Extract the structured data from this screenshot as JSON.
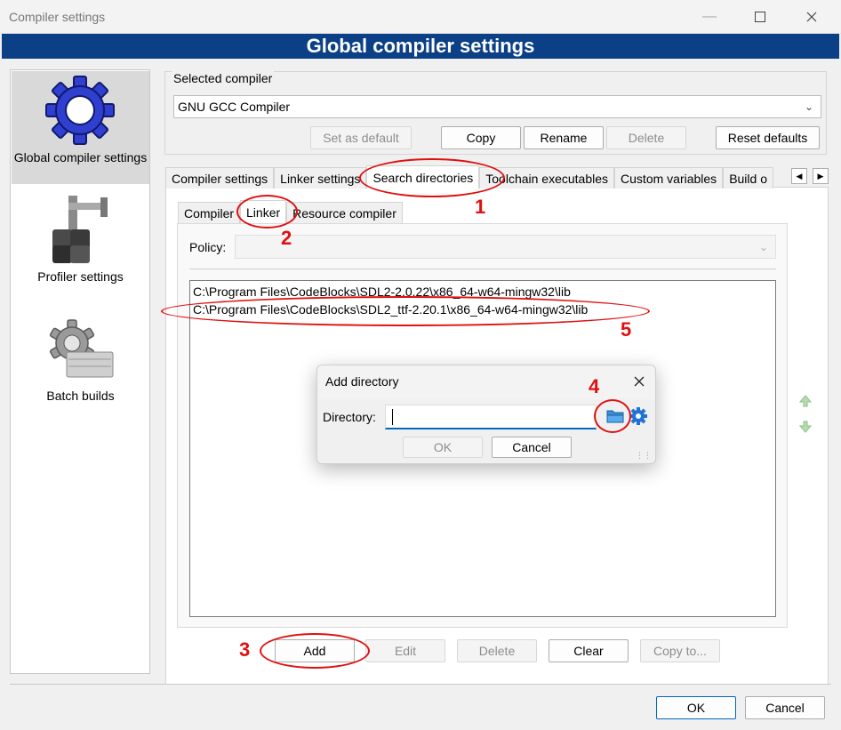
{
  "window": {
    "title": "Compiler settings",
    "banner": "Global compiler settings"
  },
  "sidebar": {
    "items": [
      {
        "label": "Global compiler settings",
        "icon": "gear-icon",
        "selected": true
      },
      {
        "label": "Profiler settings",
        "icon": "caliper-icon",
        "selected": false
      },
      {
        "label": "Batch builds",
        "icon": "batch-gear-icon",
        "selected": false
      }
    ]
  },
  "compiler_group": {
    "label": "Selected compiler",
    "selected": "GNU GCC Compiler",
    "buttons": {
      "set_default": "Set as default",
      "copy": "Copy",
      "rename": "Rename",
      "delete": "Delete",
      "reset": "Reset defaults"
    }
  },
  "main_tabs": [
    "Compiler settings",
    "Linker settings",
    "Search directories",
    "Toolchain executables",
    "Custom variables",
    "Build o"
  ],
  "sub_tabs": [
    "Compiler",
    "Linker",
    "Resource compiler"
  ],
  "policy": {
    "label": "Policy:",
    "value": ""
  },
  "directories": [
    "C:\\Program Files\\CodeBlocks\\SDL2-2.0.22\\x86_64-w64-mingw32\\lib",
    "C:\\Program Files\\CodeBlocks\\SDL2_ttf-2.20.1\\x86_64-w64-mingw32\\lib"
  ],
  "list_buttons": {
    "add": "Add",
    "edit": "Edit",
    "delete": "Delete",
    "clear": "Clear",
    "copy_to": "Copy to..."
  },
  "dialog": {
    "title": "Add directory",
    "label": "Directory:",
    "value": "",
    "ok": "OK",
    "cancel": "Cancel"
  },
  "footer": {
    "ok": "OK",
    "cancel": "Cancel"
  },
  "annotations": [
    "1",
    "2",
    "3",
    "4",
    "5"
  ],
  "colors": {
    "banner": "#0b3f86",
    "annotation": "#e01010",
    "accent": "#0067c0"
  }
}
